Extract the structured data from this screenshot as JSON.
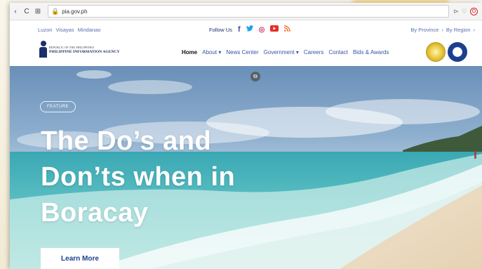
{
  "browser": {
    "url": "pia.gov.ph",
    "back_icon": "back-arrow-icon",
    "refresh_icon": "refresh-icon"
  },
  "topbar": {
    "regions": [
      "Luzon",
      "Visayas",
      "Mindanao"
    ],
    "follow_label": "Follow Us",
    "by_province": "By Province",
    "by_region": "By Region",
    "social": [
      {
        "name": "facebook-icon",
        "glyph": "f",
        "color": "#3b5998"
      },
      {
        "name": "twitter-icon",
        "glyph": "🐦",
        "color": "#1da1f2"
      },
      {
        "name": "instagram-icon",
        "glyph": "◎",
        "color": "#d8336d"
      },
      {
        "name": "youtube-icon",
        "glyph": "▶",
        "color": "#e52d27"
      },
      {
        "name": "rss-icon",
        "glyph": "ʼ",
        "color": "#f26522"
      }
    ]
  },
  "logo": {
    "small_text": "REPUBLIC OF THE PHILIPPINES",
    "main_text": "PHILIPPINE INFORMATION AGENCY"
  },
  "nav": {
    "items": [
      "Home",
      "About ▾",
      "News Center",
      "Government ▾",
      "Careers",
      "Contact",
      "Bids & Awards"
    ]
  },
  "hero": {
    "tag": "FEATURE",
    "headline_lines": [
      "The Do’s and",
      "Don’ts when in",
      "Boracay"
    ],
    "button_label": "Learn More"
  },
  "colors": {
    "brand_blue": "#1c2f6d",
    "link_blue": "#3755a6"
  }
}
